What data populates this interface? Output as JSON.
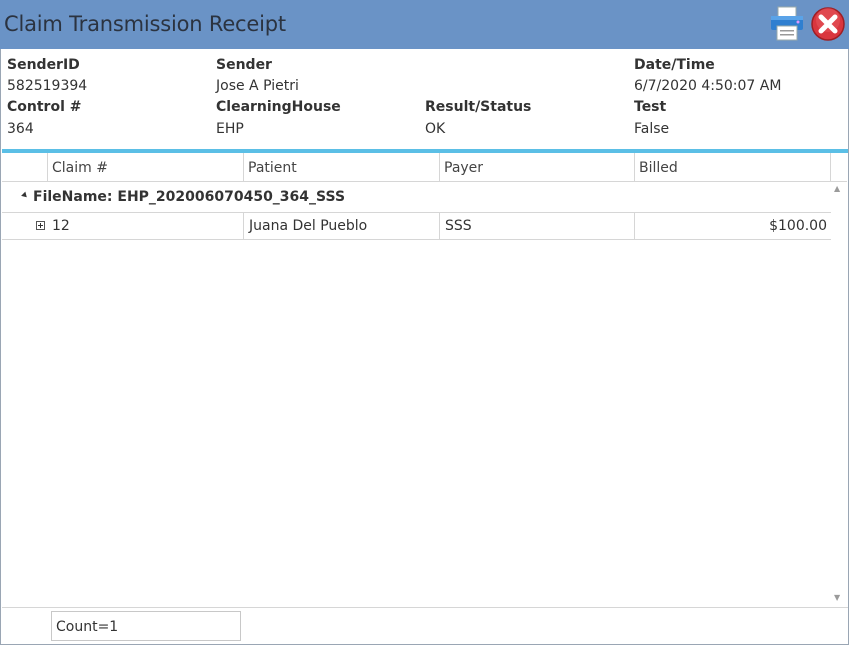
{
  "window": {
    "title": "Claim Transmission Receipt"
  },
  "header": {
    "sender_id_label": "SenderID",
    "sender_id": "582519394",
    "sender_label": "Sender",
    "sender": "Jose A Pietri",
    "datetime_label": "Date/Time",
    "datetime": "6/7/2020 4:50:07 AM",
    "control_label": "Control #",
    "control": "364",
    "clearinghouse_label": "ClearningHouse",
    "clearinghouse": "EHP",
    "result_label": "Result/Status",
    "result": "OK",
    "test_label": "Test",
    "test": "False"
  },
  "grid": {
    "columns": [
      "Claim #",
      "Patient",
      "Payer",
      "Billed"
    ],
    "group": "FileName: EHP_202006070450_364_SSS",
    "rows": [
      {
        "claim": "12",
        "patient": "Juana Del Pueblo",
        "payer": "SSS",
        "billed": "$100.00"
      }
    ]
  },
  "footer": {
    "count": "Count=1"
  },
  "icons": {
    "print": "printer-icon",
    "close": "close-icon"
  },
  "colors": {
    "titlebar": "#6a93c6",
    "separator": "#5bbfe6",
    "close": "#d9363e"
  }
}
